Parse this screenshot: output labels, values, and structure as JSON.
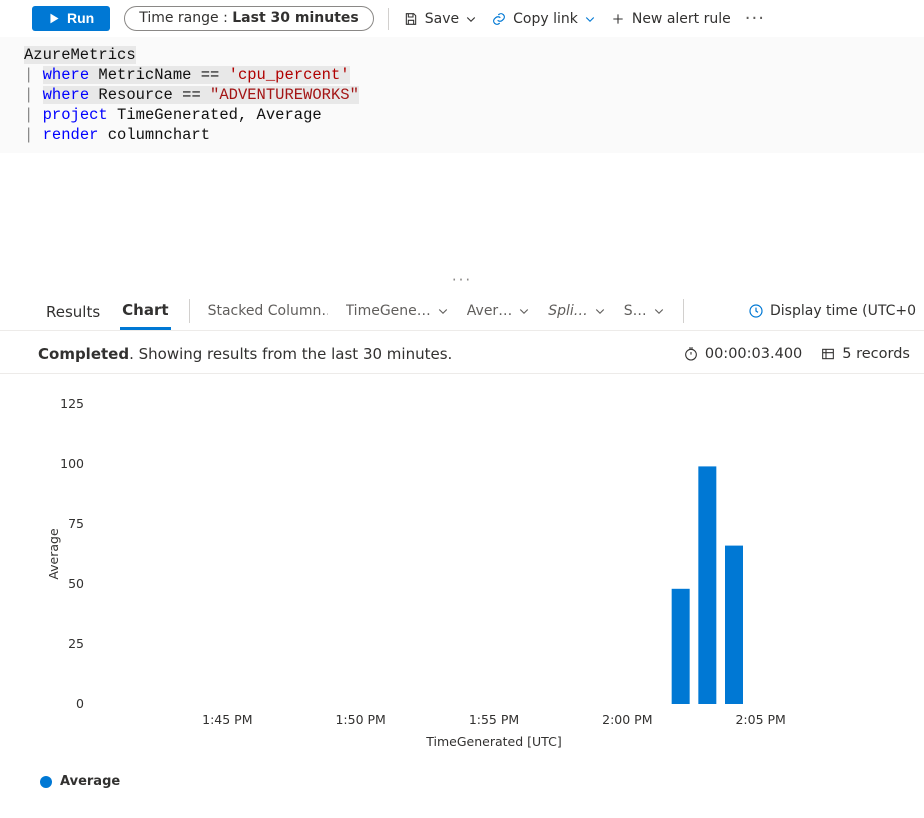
{
  "toolbar": {
    "run_label": "Run",
    "time_prefix": "Time range : ",
    "time_value": "Last 30 minutes",
    "save_label": "Save",
    "copy_label": "Copy link",
    "newalert_label": "New alert rule"
  },
  "query": {
    "lines": [
      {
        "plain": "AzureMetrics",
        "hl": true
      },
      {
        "pipe": true,
        "kw": "where",
        "rest": "MetricName == ",
        "str": "'cpu_percent'",
        "strCls": "kw-str1",
        "hl": true
      },
      {
        "pipe": true,
        "kw": "where",
        "rest": "Resource == ",
        "str": "\"ADVENTUREWORKS\"",
        "strCls": "kw-str2",
        "hl": true
      },
      {
        "pipe": true,
        "kw": "project",
        "rest": "TimeGenerated, Average",
        "hl": false
      },
      {
        "pipe": true,
        "kw": "render",
        "rest": "columnchart",
        "hl": false
      }
    ]
  },
  "tabs": {
    "results": "Results",
    "chart": "Chart"
  },
  "chartOptions": {
    "type": "Stacked Column…",
    "xaxis": "TimeGene…",
    "yaxis": "Aver…",
    "split": "Spli…",
    "agg": "S…"
  },
  "displayTime": "Display time (UTC+0",
  "status": {
    "completed_bold": "Completed",
    "completed_rest": ". Showing results from the last 30 minutes.",
    "duration": "00:00:03.400",
    "records": "5 records"
  },
  "chart_data": {
    "type": "bar",
    "title": "",
    "xlabel": "TimeGenerated [UTC]",
    "ylabel": "Average",
    "ylim": [
      0,
      125
    ],
    "yticks": [
      0,
      25,
      50,
      75,
      100,
      125
    ],
    "x_categories": [
      "1:45 PM",
      "1:50 PM",
      "1:55 PM",
      "2:00 PM",
      "2:05 PM"
    ],
    "series": [
      {
        "name": "Average",
        "points": [
          {
            "time": "2:02 PM",
            "value": 48
          },
          {
            "time": "2:03 PM",
            "value": 99
          },
          {
            "time": "2:04 PM",
            "value": 66
          }
        ]
      }
    ],
    "legend": "Average",
    "accent": "#0078d4"
  }
}
